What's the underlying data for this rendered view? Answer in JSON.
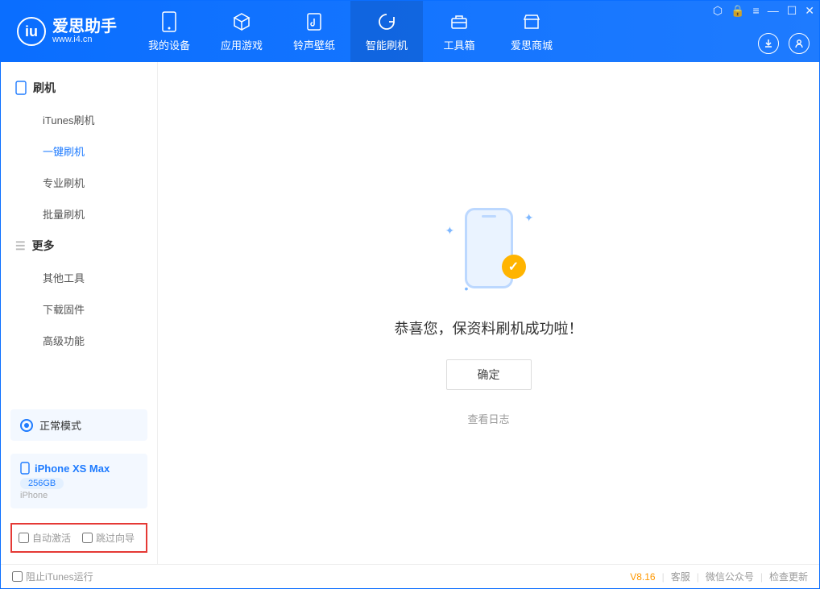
{
  "brand": {
    "title": "爱思助手",
    "sub": "www.i4.cn"
  },
  "tabs": [
    {
      "id": "device",
      "label": "我的设备"
    },
    {
      "id": "apps",
      "label": "应用游戏"
    },
    {
      "id": "ring",
      "label": "铃声壁纸"
    },
    {
      "id": "flash",
      "label": "智能刷机",
      "active": true
    },
    {
      "id": "tools",
      "label": "工具箱"
    },
    {
      "id": "store",
      "label": "爱思商城"
    }
  ],
  "sidebar": {
    "group1": {
      "title": "刷机",
      "items": [
        {
          "id": "itunes",
          "label": "iTunes刷机"
        },
        {
          "id": "oneclick",
          "label": "一键刷机",
          "active": true
        },
        {
          "id": "pro",
          "label": "专业刷机"
        },
        {
          "id": "batch",
          "label": "批量刷机"
        }
      ]
    },
    "group2": {
      "title": "更多",
      "items": [
        {
          "id": "other",
          "label": "其他工具"
        },
        {
          "id": "fw",
          "label": "下载固件"
        },
        {
          "id": "adv",
          "label": "高级功能"
        }
      ]
    }
  },
  "mode": {
    "label": "正常模式"
  },
  "device": {
    "name": "iPhone XS Max",
    "storage": "256GB",
    "type": "iPhone"
  },
  "options": {
    "auto_activate": "自动激活",
    "skip_guide": "跳过向导"
  },
  "main": {
    "message": "恭喜您，保资料刷机成功啦！",
    "ok": "确定",
    "view_log": "查看日志"
  },
  "status": {
    "block_itunes": "阻止iTunes运行",
    "version": "V8.16",
    "links": [
      "客服",
      "微信公众号",
      "检查更新"
    ]
  }
}
